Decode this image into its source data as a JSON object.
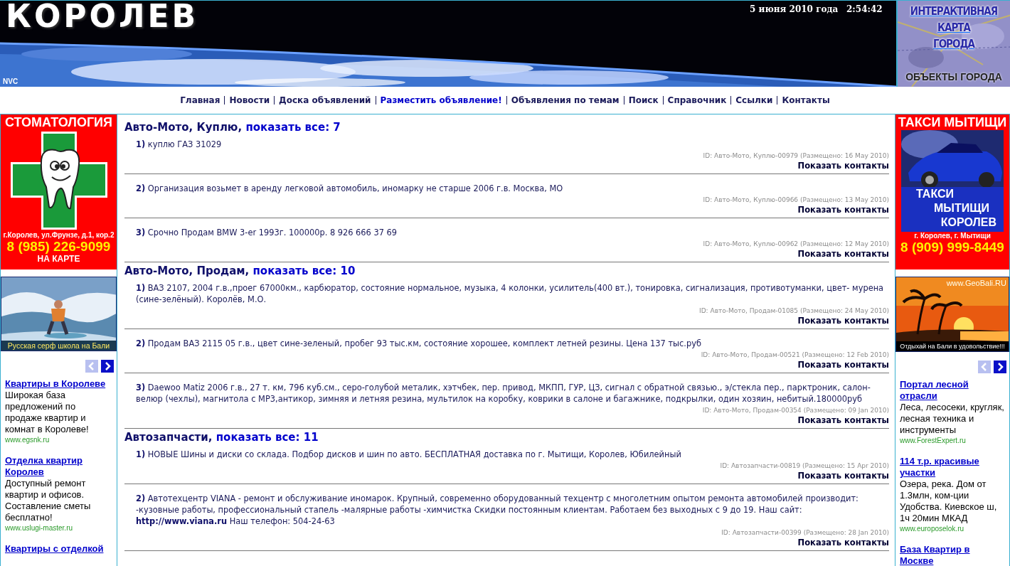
{
  "header": {
    "logo": "КОРОЛЕВ",
    "logo_sub": "NVC",
    "date": "5 июня 2010 года",
    "time": "2:54:42",
    "map_ad": {
      "lines": [
        "ИНТЕРАКТИВНАЯ",
        "КАРТА",
        "ГОРОДА"
      ],
      "caption": "ОБЪЕКТЫ ГОРОДА"
    }
  },
  "nav": [
    {
      "label": "Главная",
      "highlight": false
    },
    {
      "label": "Новости",
      "highlight": false
    },
    {
      "label": "Доска объявлений",
      "highlight": false
    },
    {
      "label": "Разместить объявление!",
      "highlight": true
    },
    {
      "label": "Объявления по темам",
      "highlight": false
    },
    {
      "label": "Поиск",
      "highlight": false
    },
    {
      "label": "Справочник",
      "highlight": false
    },
    {
      "label": "Ссылки",
      "highlight": false
    },
    {
      "label": "Контакты",
      "highlight": false
    }
  ],
  "left_sidebar": {
    "dental_ad": {
      "title": "СТОМАТОЛОГИЯ",
      "address": "г.Королев, ул.Фрунзе, д.1, кор.2",
      "phone": "8 (985) 226-9099",
      "map_link": "НА КАРТЕ"
    },
    "surf_banner": {
      "caption": "Русская серф школа на Бали"
    },
    "pager": {
      "prev_enabled": false,
      "next_enabled": true
    },
    "text_ads": [
      {
        "title": "Квартиры в Королеве",
        "body": "Широкая база предложений по продаже квартир и комнат в Королеве!",
        "url": "www.egsnk.ru"
      },
      {
        "title": "Отделка квартир Королев",
        "body": "Доступный ремонт квартир и офисов. Составление сметы бесплатно!",
        "url": "www.uslugi-master.ru"
      },
      {
        "title": "Квартиры с отделкой"
      }
    ]
  },
  "right_sidebar": {
    "taxi_ad": {
      "title": "ТАКСИ МЫТИЩИ",
      "lines": [
        "ТАКСИ",
        "МЫТИЩИ",
        "КОРОЛЕВ"
      ],
      "address": "г. Королев, г. Мытищи",
      "phone": "8 (909) 999-8449"
    },
    "bali_banner": {
      "site": "www.GeoBali.RU",
      "caption": "Отдыхай на Бали в удовольствие!!!"
    },
    "pager": {
      "prev_enabled": false,
      "next_enabled": true
    },
    "text_ads": [
      {
        "title": "Портал лесной отрасли",
        "body": "Леса, лесосеки, кругляк, лесная техника и инструменты",
        "url": "www.ForestExpert.ru"
      },
      {
        "title": "114 т.р. красивые участки",
        "body": "Озера, река. Дом от 1.3млн, ком-ции Удобства. Киевское ш, 1ч 20мин МКАД",
        "url": "www.europoselok.ru"
      },
      {
        "title": "База Квартир в Москве"
      }
    ]
  },
  "sections": [
    {
      "category": "Авто-Мото, Куплю,",
      "show_all": "показать все: 7",
      "items": [
        {
          "number": "1)",
          "text": "куплю ГАЗ 31029",
          "id_line": "ID: Авто-Мото, Куплю-00979 (Размещено: 16 May 2010)",
          "contacts": "Показать контакты"
        },
        {
          "number": "2)",
          "text": "Организация возьмет в аренду легковой автомобиль, иномарку не старше 2006 г.в. Москва, МО",
          "id_line": "ID: Авто-Мото, Куплю-00966 (Размещено: 13 May 2010)",
          "contacts": "Показать контакты"
        },
        {
          "number": "3)",
          "text": "Срочно Продам BMW 3-er 1993г. 100000р. 8 926 666 37 69",
          "id_line": "ID: Авто-Мото, Куплю-00962 (Размещено: 12 May 2010)",
          "contacts": "Показать контакты"
        }
      ]
    },
    {
      "category": "Авто-Мото, Продам,",
      "show_all": "показать все: 10",
      "items": [
        {
          "number": "1)",
          "text": "ВАЗ 2107, 2004 г.в.,проег 67000км., карбюратор, состояние нормальное, музыка, 4 колонки, усилитель(400 вт.), тонировка, сигнализация, противотуманки, цвет- мурена (сине-зелёный). Королёв, М.О.",
          "id_line": "ID: Авто-Мото, Продам-01085 (Размещено: 24 May 2010)",
          "contacts": "Показать контакты"
        },
        {
          "number": "2)",
          "text": "Продам ВАЗ 2115 05 г.в., цвет сине-зеленый, пробег 93 тыс.км, состояние хорошее, комплект летней резины. Цена 137 тыс.руб",
          "id_line": "ID: Авто-Мото, Продам-00521 (Размещено: 12 Feb 2010)",
          "contacts": "Показать контакты"
        },
        {
          "number": "3)",
          "text": "Daewoo Matiz 2006 г.в., 27 т. км, 796 куб.см., серо-голубой металик, хэтчбек, пер. привод, МКПП, ГУР, ЦЗ, сигнал с обратной связью., э/стекла пер., парктроник, салон-велюр (чехлы), магнитола с MP3,антикор, зимняя и летняя резина, мультилок на коробку, коврики в салоне и багажнике, подкрылки, один хозяин, небитый.180000руб",
          "id_line": "ID: Авто-Мото, Продам-00354 (Размещено: 09 Jan 2010)",
          "contacts": "Показать контакты"
        }
      ]
    },
    {
      "category": "Автозапчасти,",
      "show_all": "показать все: 11",
      "items": [
        {
          "number": "1)",
          "text": "НОВЫЕ Шины и диски со склада. Подбор дисков и шин по авто. БЕСПЛАТНАЯ доставка по г. Мытищи, Королев, Юбилейный",
          "id_line": "ID: Автозапчасти-00819 (Размещено: 15 Apr 2010)",
          "contacts": "Показать контакты"
        },
        {
          "number": "2)",
          "text": "Автотехцентр VIANA - ремонт и обслуживание иномарок. Крупный, современно оборудованный техцентр с многолетним опытом ремонта автомобилей производит: -кузовные работы, профессиональный стапель -малярные работы -химчистка Скидки постоянным клиентам. Работаем без выходных с 9 до 19. Наш сайт: **http://www.viana.ru** Наш телефон: 504-24-63",
          "id_line": "ID: Автозапчасти-00399 (Размещено: 28 Jan 2010)",
          "contacts": "Показать контакты"
        }
      ]
    }
  ]
}
